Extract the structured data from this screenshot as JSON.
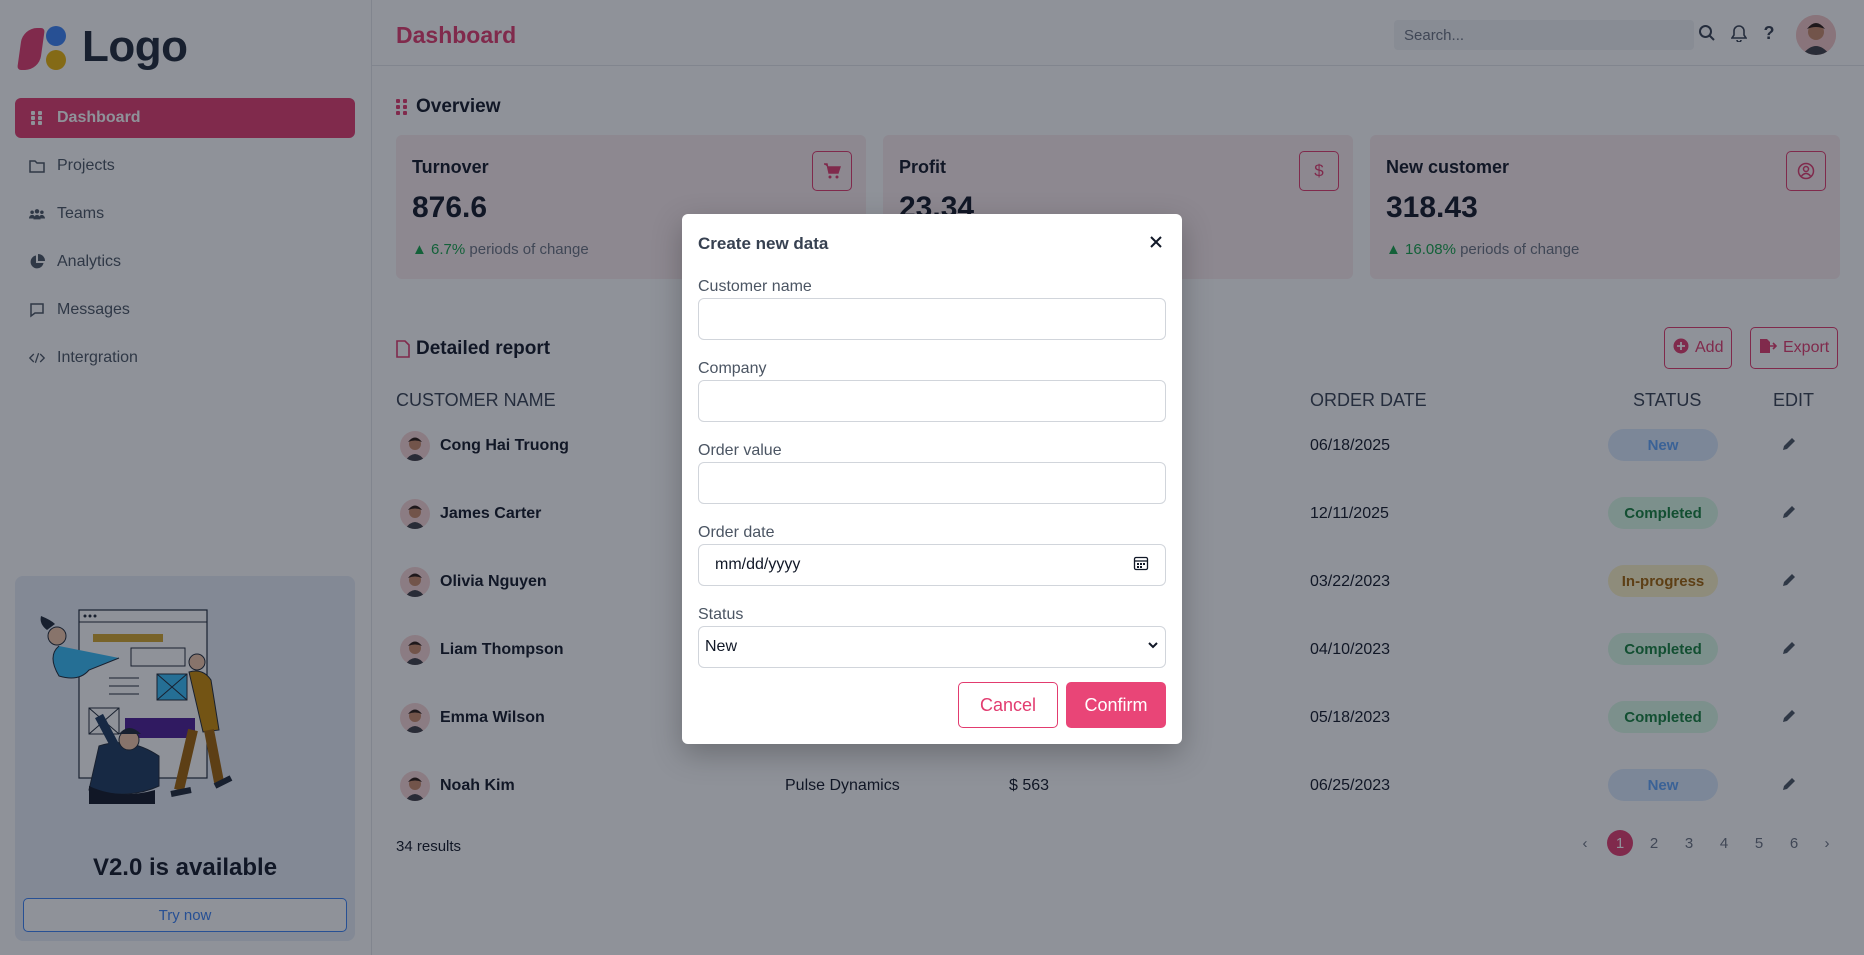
{
  "app": {
    "logo_text": "Logo"
  },
  "sidebar": {
    "items": [
      {
        "label": "Dashboard",
        "icon": "grid-icon",
        "active": true
      },
      {
        "label": "Projects",
        "icon": "folder-icon"
      },
      {
        "label": "Teams",
        "icon": "team-icon"
      },
      {
        "label": "Analytics",
        "icon": "pie-chart-icon"
      },
      {
        "label": "Messages",
        "icon": "message-icon"
      },
      {
        "label": "Intergration",
        "icon": "code-icon"
      }
    ],
    "promo": {
      "title": "V2.0 is available",
      "button": "Try now"
    }
  },
  "header": {
    "title": "Dashboard",
    "search_placeholder": "Search..."
  },
  "overview": {
    "title": "Overview",
    "cards": [
      {
        "label": "Turnover",
        "value": "876.6",
        "change": "6.7%",
        "change_text": "periods of change",
        "icon": "cart-icon"
      },
      {
        "label": "Profit",
        "value": "23.34",
        "change": "",
        "change_text": "",
        "icon": "dollar-icon"
      },
      {
        "label": "New customer",
        "value": "318.43",
        "change": "16.08%",
        "change_text": "periods of change",
        "icon": "user-circle-icon"
      }
    ]
  },
  "report": {
    "title": "Detailed report",
    "add_label": "Add",
    "export_label": "Export",
    "columns": {
      "customer": "CUSTOMER NAME",
      "order_date": "ORDER DATE",
      "status": "STATUS",
      "edit": "EDIT"
    },
    "rows": [
      {
        "name": "Cong Hai Truong",
        "company": "",
        "value": "",
        "date": "06/18/2025",
        "status": "New"
      },
      {
        "name": "James Carter",
        "company": "",
        "value": "",
        "date": "12/11/2025",
        "status": "Completed"
      },
      {
        "name": "Olivia Nguyen",
        "company": "",
        "value": "",
        "date": "03/22/2023",
        "status": "In-progress"
      },
      {
        "name": "Liam Thompson",
        "company": "",
        "value": "",
        "date": "04/10/2023",
        "status": "Completed"
      },
      {
        "name": "Emma Wilson",
        "company": "",
        "value": "",
        "date": "05/18/2023",
        "status": "Completed"
      },
      {
        "name": "Noah Kim",
        "company": "Pulse Dynamics",
        "value": "$ 563",
        "date": "06/25/2023",
        "status": "New"
      }
    ],
    "results": "34 results",
    "pagination": {
      "prev": "‹",
      "pages": [
        "1",
        "2",
        "3",
        "4",
        "5",
        "6"
      ],
      "next": "›",
      "current": "1"
    }
  },
  "modal": {
    "title": "Create new data",
    "fields": {
      "customer_name": {
        "label": "Customer name",
        "value": ""
      },
      "company": {
        "label": "Company",
        "value": ""
      },
      "order_value": {
        "label": "Order value",
        "value": ""
      },
      "order_date": {
        "label": "Order date",
        "placeholder": "mm/dd/yyyy"
      },
      "status": {
        "label": "Status",
        "value": "New"
      }
    },
    "cancel": "Cancel",
    "confirm": "Confirm"
  },
  "colors": {
    "accent": "#e23b6f",
    "confirm": "#e94577",
    "status_new": "#60a5fa",
    "status_completed": "#15803d",
    "status_inprogress": "#a16207"
  }
}
